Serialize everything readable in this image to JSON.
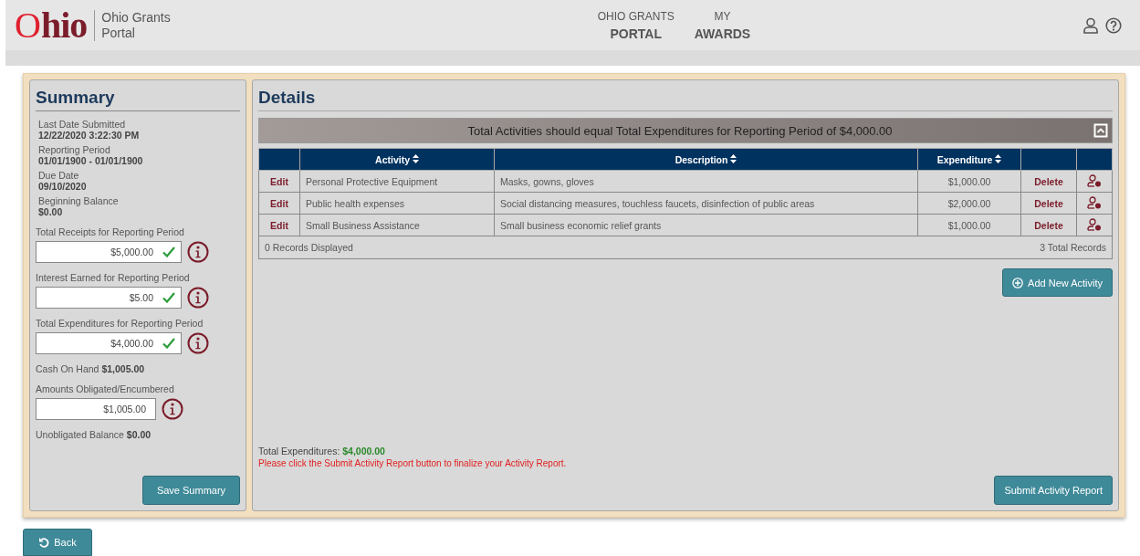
{
  "header": {
    "logo": {
      "first": "O",
      "rest": "hio"
    },
    "portal_name": [
      "Ohio Grants",
      "Portal"
    ],
    "nav": [
      {
        "top": "OHIO GRANTS",
        "bottom": "PORTAL"
      },
      {
        "top": "MY",
        "bottom": "AWARDS"
      }
    ]
  },
  "summary": {
    "title": "Summary",
    "info": [
      {
        "label": "Last Date Submitted",
        "value": "12/22/2020 3:22:30 PM"
      },
      {
        "label": "Reporting Period",
        "value": "01/01/1900 - 01/01/1900"
      },
      {
        "label": "Due Date",
        "value": "09/10/2020"
      },
      {
        "label": "Beginning Balance",
        "value": "$0.00"
      }
    ],
    "fields": [
      {
        "kind": "input",
        "label": "Total Receipts for Reporting Period",
        "value": "$5,000.00",
        "valid": true
      },
      {
        "kind": "input",
        "label": "Interest Earned for Reporting Period",
        "value": "$5.00",
        "valid": true
      },
      {
        "kind": "input",
        "label": "Total Expenditures for Reporting Period",
        "value": "$4,000.00",
        "valid": true
      },
      {
        "kind": "total",
        "label": "Cash On Hand",
        "value": "$1,005.00"
      },
      {
        "kind": "input",
        "label": "Amounts Obligated/Encumbered",
        "value": "$1,005.00",
        "valid": false
      },
      {
        "kind": "total",
        "label": "Unobligated Balance",
        "value": "$0.00"
      }
    ],
    "save_button": "Save Summary"
  },
  "details": {
    "title": "Details",
    "banner": "Total Activities should equal Total Expenditures for Reporting Period of $4,000.00",
    "table": {
      "columns": [
        {
          "label": "Activity",
          "sortable": true
        },
        {
          "label": "Description",
          "sortable": true
        },
        {
          "label": "Expenditure",
          "sortable": true
        }
      ],
      "rows": [
        {
          "edit": "Edit",
          "activity": "Personal Protective Equipment",
          "description": "Masks, gowns, gloves",
          "expenditure": "$1,000.00",
          "delete": "Delete"
        },
        {
          "edit": "Edit",
          "activity": "Public health expenses",
          "description": "Social distancing measures, touchless faucets, disinfection of public areas",
          "expenditure": "$2,000.00",
          "delete": "Delete"
        },
        {
          "edit": "Edit",
          "activity": "Small Business Assistance",
          "description": "Small business economic relief grants",
          "expenditure": "$1,000.00",
          "delete": "Delete"
        }
      ],
      "footer_left": "0 Records Displayed",
      "footer_right": "3 Total Records"
    },
    "add_button": "Add New Activity",
    "total_label": "Total Expenditures:",
    "total_value": "$4,000.00",
    "notice": "Please click the Submit Activity Report button to finalize your Activity Report.",
    "submit_button": "Submit Activity Report"
  },
  "back_button": "Back"
}
